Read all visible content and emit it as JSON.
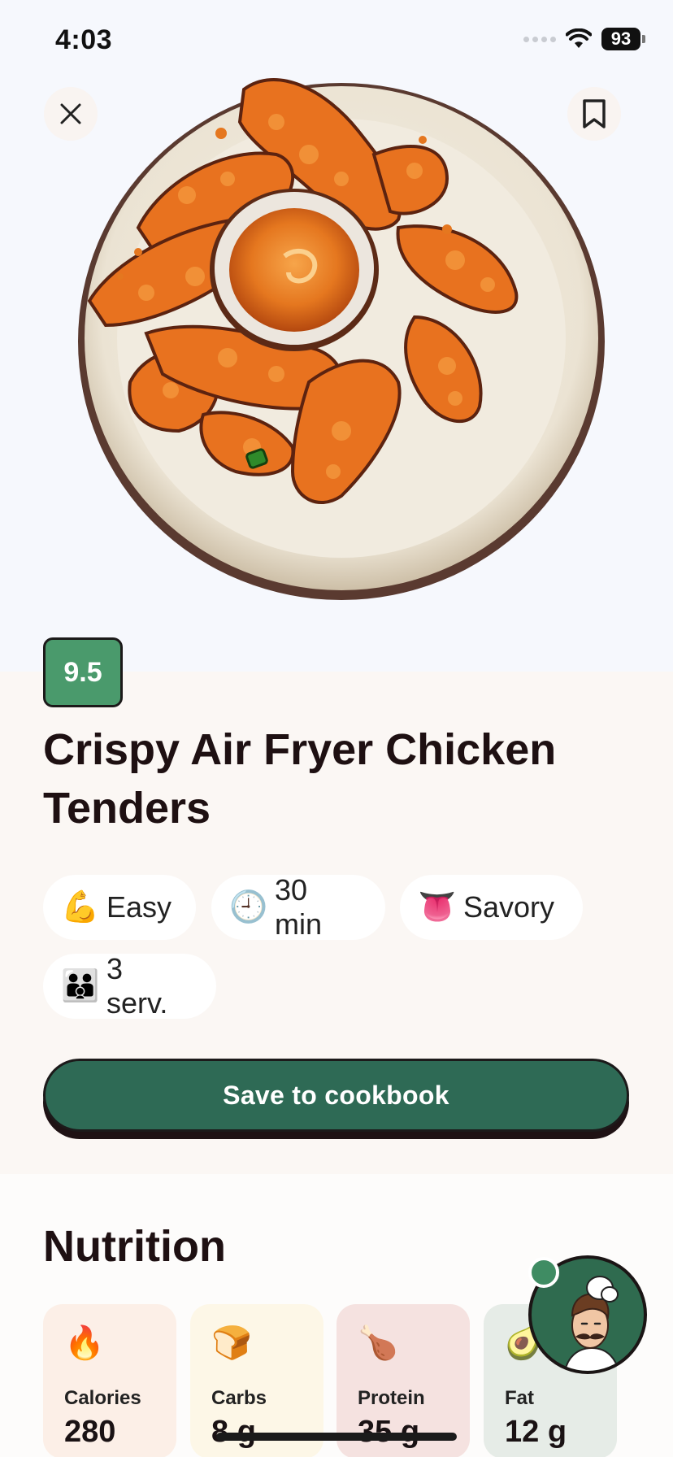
{
  "status_bar": {
    "time": "4:03",
    "battery": "93"
  },
  "hero": {
    "image_alt": "Crispy chicken tenders on a plate with dipping sauce"
  },
  "recipe": {
    "rating": "9.5",
    "title": "Crispy Air Fryer Chicken Tenders",
    "tags": [
      {
        "icon": "💪",
        "icon_name": "flexed-biceps-icon",
        "label": "Easy"
      },
      {
        "icon": "🕘",
        "icon_name": "clock-icon",
        "label": "30 min"
      },
      {
        "icon": "👅",
        "icon_name": "tongue-icon",
        "label": "Savory"
      },
      {
        "icon": "👪",
        "icon_name": "family-icon",
        "label": "3 serv."
      }
    ],
    "save_label": "Save to cookbook"
  },
  "nutrition": {
    "title": "Nutrition",
    "items": [
      {
        "icon": "🔥",
        "icon_name": "fire-icon",
        "label": "Calories",
        "value": "280"
      },
      {
        "icon": "🍞",
        "icon_name": "bread-icon",
        "label": "Carbs",
        "value": "8 g"
      },
      {
        "icon": "🍗",
        "icon_name": "drumstick-icon",
        "label": "Protein",
        "value": "35 g"
      },
      {
        "icon": "🥑",
        "icon_name": "avocado-icon",
        "label": "Fat",
        "value": "12 g"
      }
    ]
  },
  "colors": {
    "accent_green": "#2e6a55",
    "badge_green": "#4a9a6c",
    "title_text": "#1e1012"
  }
}
